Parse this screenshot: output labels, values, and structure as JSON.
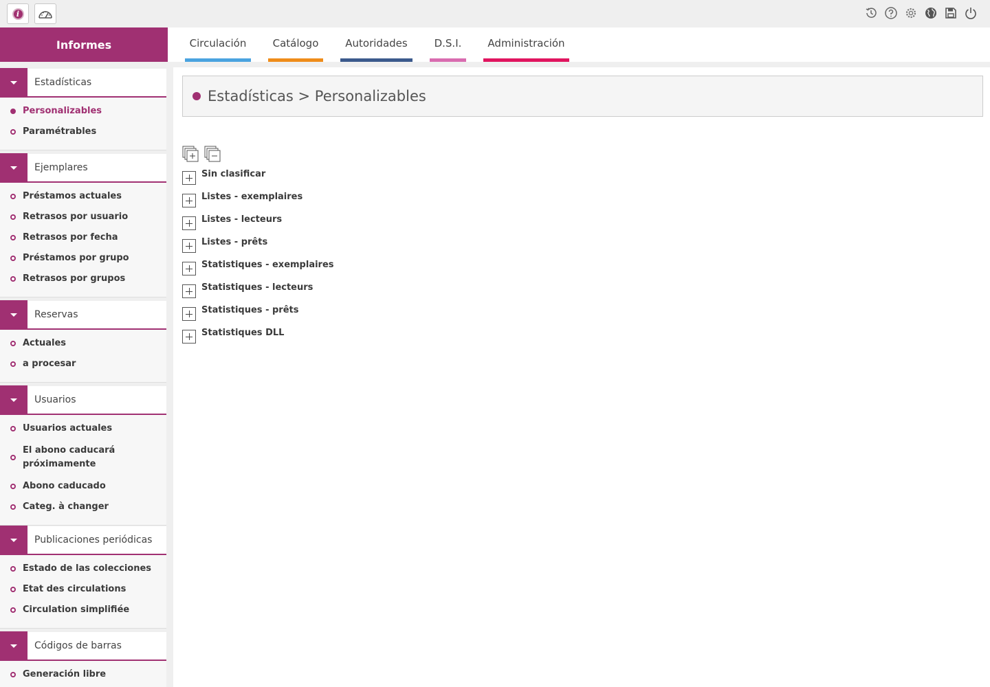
{
  "topbar": {
    "left_buttons": [
      {
        "icon": "info-icon"
      },
      {
        "icon": "dashboard-icon"
      }
    ],
    "right_icons": [
      "history-icon",
      "help-icon",
      "settings-icon",
      "globe-icon",
      "save-icon",
      "power-icon"
    ]
  },
  "left_header": {
    "title": "Informes"
  },
  "tabs": [
    {
      "label": "Circulación",
      "color": "#4aa3df"
    },
    {
      "label": "Catálogo",
      "color": "#ef8c1a"
    },
    {
      "label": "Autoridades",
      "color": "#3b5a8c"
    },
    {
      "label": "D.S.I.",
      "color": "#d96cb0"
    },
    {
      "label": "Administración",
      "color": "#e0155f"
    }
  ],
  "sidebar": {
    "sections": [
      {
        "title": "Estadísticas",
        "items": [
          "Personalizables",
          "Paramétrables"
        ],
        "active_index": 0
      },
      {
        "title": "Ejemplares",
        "items": [
          "Préstamos actuales",
          "Retrasos por usuario",
          "Retrasos por fecha",
          "Préstamos por grupo",
          "Retrasos por grupos"
        ]
      },
      {
        "title": "Reservas",
        "items": [
          "Actuales",
          "a procesar"
        ]
      },
      {
        "title": "Usuarios",
        "items": [
          "Usuarios actuales",
          "El abono caducará próximamente",
          "Abono caducado",
          "Categ. à changer"
        ]
      },
      {
        "title": "Publicaciones periódicas",
        "items": [
          "Estado de las colecciones",
          "Etat des circulations",
          "Circulation simplifiée"
        ]
      },
      {
        "title": "Códigos de barras",
        "items": [
          "Generación libre"
        ]
      }
    ]
  },
  "main": {
    "breadcrumb": "Estadísticas > Personalizables",
    "tools": [
      "expand-all-icon",
      "collapse-all-icon"
    ],
    "tree": [
      "Sin clasificar",
      "Listes - exemplaires",
      "Listes - lecteurs",
      "Listes - prêts",
      "Statistiques - exemplaires",
      "Statistiques - lecteurs",
      "Statistiques - prêts",
      "Statistiques DLL"
    ]
  },
  "colors": {
    "accent": "#a03072"
  }
}
